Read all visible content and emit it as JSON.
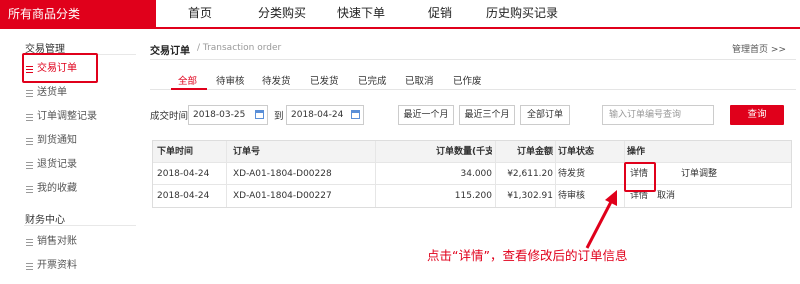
{
  "topnav": {
    "all_categories": "所有商品分类",
    "items": [
      "首页",
      "分类购买",
      "快速下单",
      "促销",
      "历史购买记录"
    ]
  },
  "sidebar": {
    "group1": "交易管理",
    "items1": [
      "交易订单",
      "送货单",
      "订单调整记录",
      "到货通知",
      "退货记录",
      "我的收藏"
    ],
    "group2": "财务中心",
    "items2": [
      "销售对账",
      "开票资料"
    ]
  },
  "main": {
    "title": "交易订单",
    "subtitle": "/ Transaction order",
    "mgmt_link": "管理首页 >>",
    "tabs": [
      "全部",
      "待审核",
      "待发货",
      "已发货",
      "已完成",
      "已取消",
      "已作废"
    ],
    "filter": {
      "date_label": "成交时间",
      "date_from": "2018-03-25",
      "to_label": "到",
      "date_to": "2018-04-24",
      "btn_month": "最近一个月",
      "btn_3months": "最近三个月",
      "btn_all": "全部订单",
      "order_placeholder": "输入订单编号查询",
      "query": "查询"
    },
    "table": {
      "headers": [
        "下单时间",
        "订单号",
        "订单数量(千支)",
        "订单金额",
        "订单状态",
        "操作"
      ],
      "rows": [
        {
          "date": "2018-04-24",
          "order_no": "XD-A01-1804-D00228",
          "qty": "34.000",
          "amount": "¥2,611.20",
          "status": "待发货",
          "op1": "详情",
          "op2": "订单调整"
        },
        {
          "date": "2018-04-24",
          "order_no": "XD-A01-1804-D00227",
          "qty": "115.200",
          "amount": "¥1,302.91",
          "status": "待审核",
          "op1": "详情",
          "op2": "取消"
        }
      ]
    }
  },
  "annotation": "点击“详情”，查看修改后的订单信息",
  "colors": {
    "accent": "#e0001b"
  }
}
